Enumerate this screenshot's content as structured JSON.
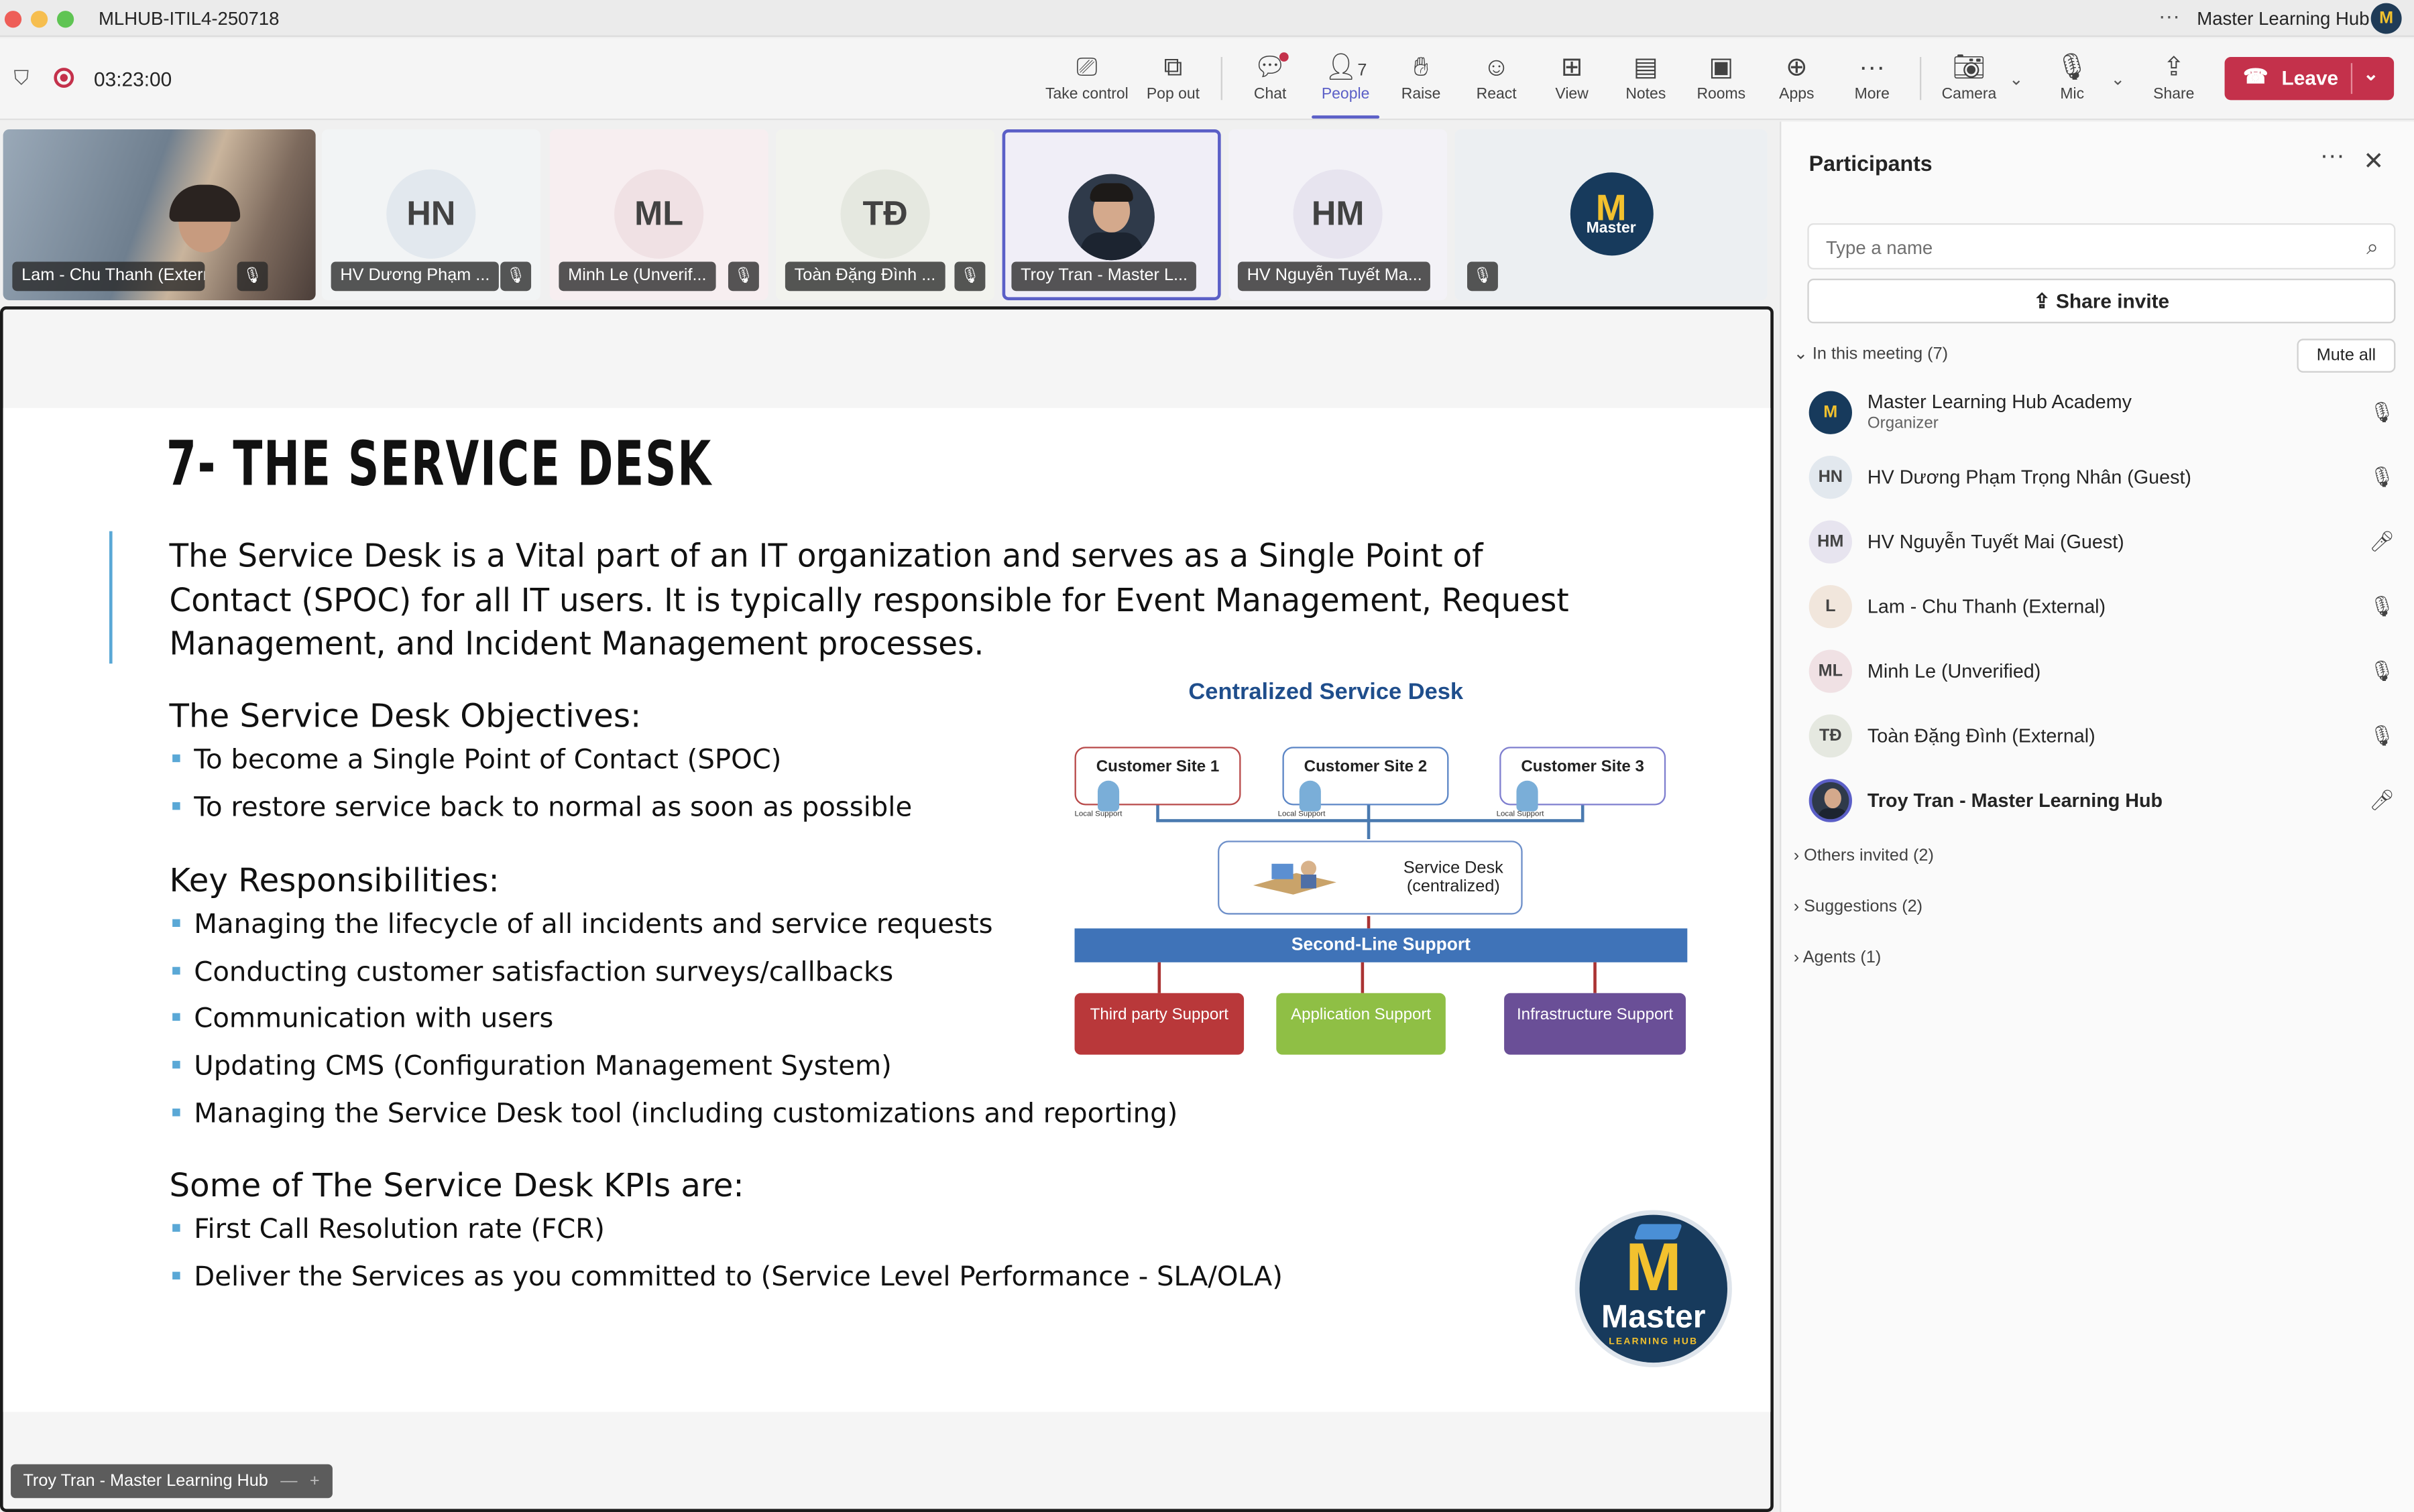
{
  "window": {
    "title": "MLHUB-ITIL4-250718",
    "org_name": "Master Learning Hub",
    "org_avatar": "M"
  },
  "meeting": {
    "timer": "03:23:00",
    "people_count": "7",
    "toolbar": {
      "take_control": "Take control",
      "pop_out": "Pop out",
      "chat": "Chat",
      "people": "People",
      "raise": "Raise",
      "react": "React",
      "view": "View",
      "notes": "Notes",
      "rooms": "Rooms",
      "apps": "Apps",
      "more": "More",
      "camera": "Camera",
      "mic": "Mic",
      "share": "Share",
      "leave": "Leave"
    }
  },
  "tiles": [
    {
      "initials": "",
      "name": "Lam - Chu Thanh (External)",
      "video": true
    },
    {
      "initials": "HN",
      "name": "HV Dương Phạm ...",
      "bg": "#e2e8ee"
    },
    {
      "initials": "ML",
      "name": "Minh Le (Unverif...",
      "bg": "#f0e1e4"
    },
    {
      "initials": "TĐ",
      "name": "Toàn Đặng Đình ...",
      "bg": "#e5e8e0"
    },
    {
      "initials": "",
      "name": "Troy Tran - Master L...",
      "video": true,
      "active": true
    },
    {
      "initials": "HM",
      "name": "HV Nguyễn Tuyết Ma...",
      "bg": "#e7e4ef"
    },
    {
      "initials": "M",
      "name": "",
      "logo": true
    }
  ],
  "slide": {
    "title": "7- THE SERVICE DESK",
    "intro": "The Service Desk is a Vital part of an IT organization and serves as a Single Point of Contact (SPOC) for all IT users. It is typically responsible for Event Management, Request Management, and Incident Management processes.",
    "objectives_heading": "The Service Desk Objectives:",
    "objectives": [
      "To become a Single Point of Contact (SPOC)",
      "To restore service back to normal as soon as possible"
    ],
    "responsibilities_heading": "Key Responsibilities:",
    "responsibilities": [
      "Managing the lifecycle of all incidents and service requests",
      "Conducting customer satisfaction surveys/callbacks",
      "Communication with users",
      "Updating CMS (Configuration Management System)",
      "Managing the Service Desk tool (including customizations and reporting)"
    ],
    "kpi_heading": "Some of The Service Desk KPIs are:",
    "kpis": [
      "First Call Resolution rate (FCR)",
      "Deliver the Services as you committed to (Service Level Performance - SLA/OLA)"
    ],
    "diagram": {
      "title": "Centralized Service Desk",
      "sites": [
        "Customer Site 1",
        "Customer Site 2",
        "Customer Site 3"
      ],
      "local_support": "Local Support",
      "service_desk": "Service Desk (centralized)",
      "second_line": "Second-Line Support",
      "supports": [
        "Third party Support",
        "Application Support",
        "Infrastructure Support"
      ]
    },
    "logo": {
      "letter": "M",
      "word": "Master",
      "sub": "LEARNING HUB"
    }
  },
  "presenter_label": "Troy Tran - Master Learning Hub",
  "panel": {
    "title": "Participants",
    "search_placeholder": "Type a name",
    "share_invite": "Share invite",
    "in_meeting": "In this meeting (7)",
    "mute_all": "Mute all",
    "participants": [
      {
        "initials": "M",
        "name": "Master Learning Hub Academy",
        "role": "Organizer",
        "mic": "muted"
      },
      {
        "initials": "HN",
        "name": "HV Dương Phạm Trọng Nhân (Guest)",
        "mic": "muted"
      },
      {
        "initials": "HM",
        "name": "HV Nguyễn Tuyết Mai (Guest)",
        "mic": "on"
      },
      {
        "initials": "L",
        "name": "Lam - Chu Thanh (External)",
        "mic": "muted"
      },
      {
        "initials": "ML",
        "name": "Minh Le (Unverified)",
        "mic": "muted"
      },
      {
        "initials": "TĐ",
        "name": "Toàn Đặng Đình (External)",
        "mic": "muted"
      },
      {
        "initials": "",
        "name": "Troy Tran - Master Learning Hub",
        "mic": "on"
      }
    ],
    "others_invited": "Others invited (2)",
    "suggestions": "Suggestions (2)",
    "agents": "Agents (1)"
  }
}
